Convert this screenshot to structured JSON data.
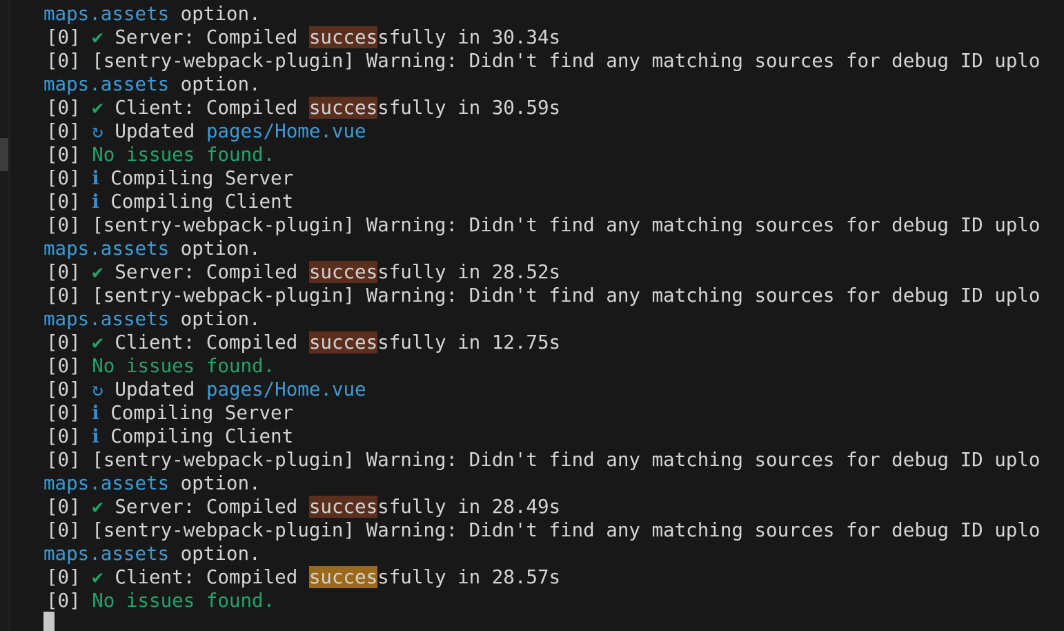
{
  "terminal": {
    "process_prefix": "[0]",
    "check_glyph": "✔",
    "refresh_glyph": "↻",
    "info_glyph": "ℹ",
    "warning_text": "[sentry-webpack-plugin] Warning: Didn't find any matching sources for debug ID uplo",
    "wrap_key": "maps.assets",
    "wrap_rest": " option.",
    "no_issues": "No issues found.",
    "updated_label": "Updated ",
    "updated_file": "pages/Home.vue",
    "compiling_server": "Compiling Server",
    "compiling_client": "Compiling Client",
    "server_label": "Server: Compiled ",
    "client_label": "Client: Compiled ",
    "success_match": "succes",
    "success_rest": "sfully in ",
    "times": [
      "30.34s",
      "30.59s",
      "28.52s",
      "12.75s",
      "28.49s",
      "28.57s"
    ]
  },
  "colors": {
    "background": "#181818",
    "text": "#d4d4d4",
    "link": "#3b9ad6",
    "success": "#23a269",
    "search_match": "#5b2f1e",
    "current_match": "#9a6a1a"
  }
}
